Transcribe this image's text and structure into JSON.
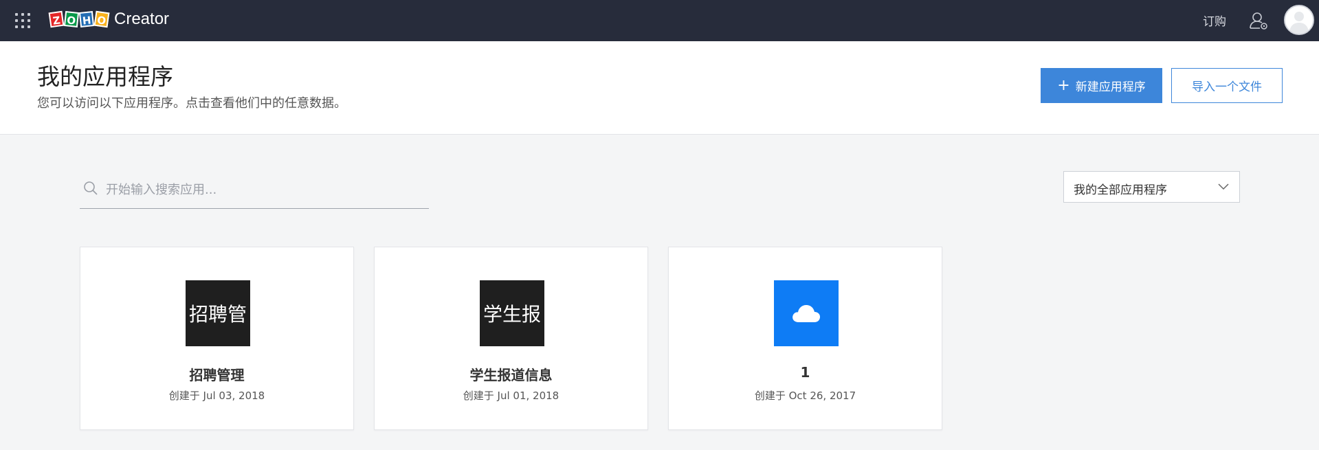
{
  "topbar": {
    "logo_letters": [
      "Z",
      "O",
      "H",
      "O"
    ],
    "product_name": "Creator",
    "subscribe_label": "订购",
    "icons": {
      "apps": "apps-grid-icon",
      "admin": "user-settings-icon",
      "avatar": "user-avatar-icon"
    }
  },
  "header": {
    "title": "我的应用程序",
    "subtitle": "您可以访问以下应用程序。点击查看他们中的任意数据。",
    "new_app_label": "新建应用程序",
    "import_label": "导入一个文件"
  },
  "search": {
    "placeholder": "开始输入搜索应用...",
    "value": ""
  },
  "filter": {
    "selected": "我的全部应用程序"
  },
  "apps": [
    {
      "icon_text": "招聘管",
      "icon_color": "#1f1f1f",
      "name": "招聘管理",
      "created": "创建于 Jul 03, 2018"
    },
    {
      "icon_text": "学生报",
      "icon_color": "#1f1f1f",
      "name": "学生报道信息",
      "created": "创建于 Jul 01, 2018"
    },
    {
      "icon_text": "",
      "icon_name": "cloud-icon",
      "icon_color": "#0e7cf5",
      "name": "1",
      "created": "创建于 Oct 26, 2017"
    }
  ],
  "colors": {
    "topbar_bg": "#272c3b",
    "accent": "#3d86da",
    "page_bg": "#f4f5f6"
  }
}
